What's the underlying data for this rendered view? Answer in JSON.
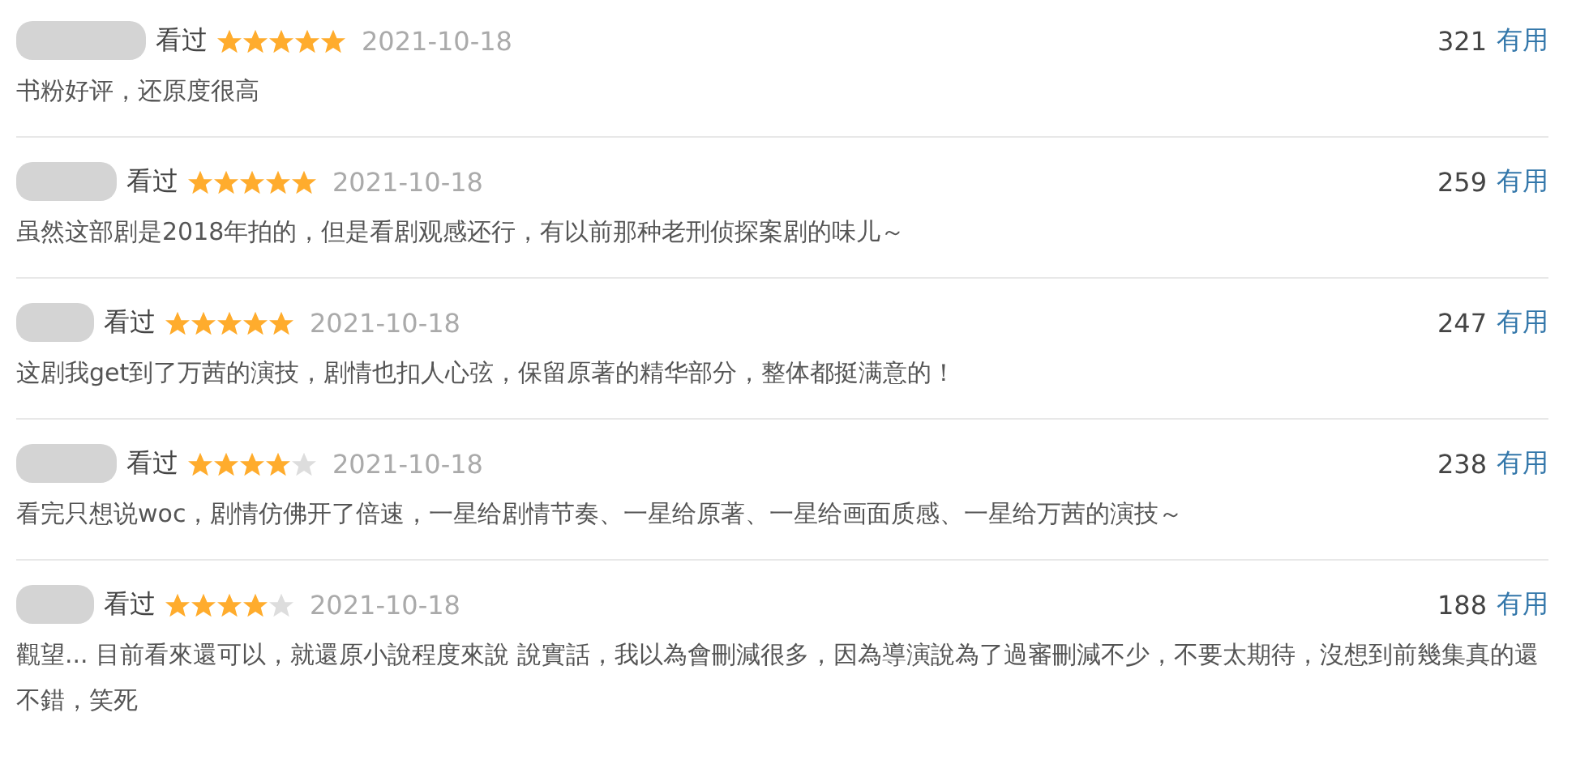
{
  "reviews": [
    {
      "status": "看过",
      "stars": 5,
      "date": "2021-10-18",
      "votes": "321",
      "vote_label": "有用",
      "comment": "书粉好评，还原度很高"
    },
    {
      "status": "看过",
      "stars": 5,
      "date": "2021-10-18",
      "votes": "259",
      "vote_label": "有用",
      "comment": "虽然这部剧是2018年拍的，但是看剧观感还行，有以前那种老刑侦探案剧的味儿～"
    },
    {
      "status": "看过",
      "stars": 5,
      "date": "2021-10-18",
      "votes": "247",
      "vote_label": "有用",
      "comment": "这剧我get到了万茜的演技，剧情也扣人心弦，保留原著的精华部分，整体都挺满意的！"
    },
    {
      "status": "看过",
      "stars": 4,
      "date": "2021-10-18",
      "votes": "238",
      "vote_label": "有用",
      "comment": "看完只想说woc，剧情仿佛开了倍速，一星给剧情节奏、一星给原著、一星给画面质感、一星给万茜的演技～"
    },
    {
      "status": "看过",
      "stars": 4,
      "date": "2021-10-18",
      "votes": "188",
      "vote_label": "有用",
      "comment": "觀望... 目前看來還可以，就還原小說程度來說 說實話，我以為會刪減很多，因為導演說為了過審刪減不少，不要太期待，沒想到前幾集真的還不錯，笑死"
    }
  ]
}
